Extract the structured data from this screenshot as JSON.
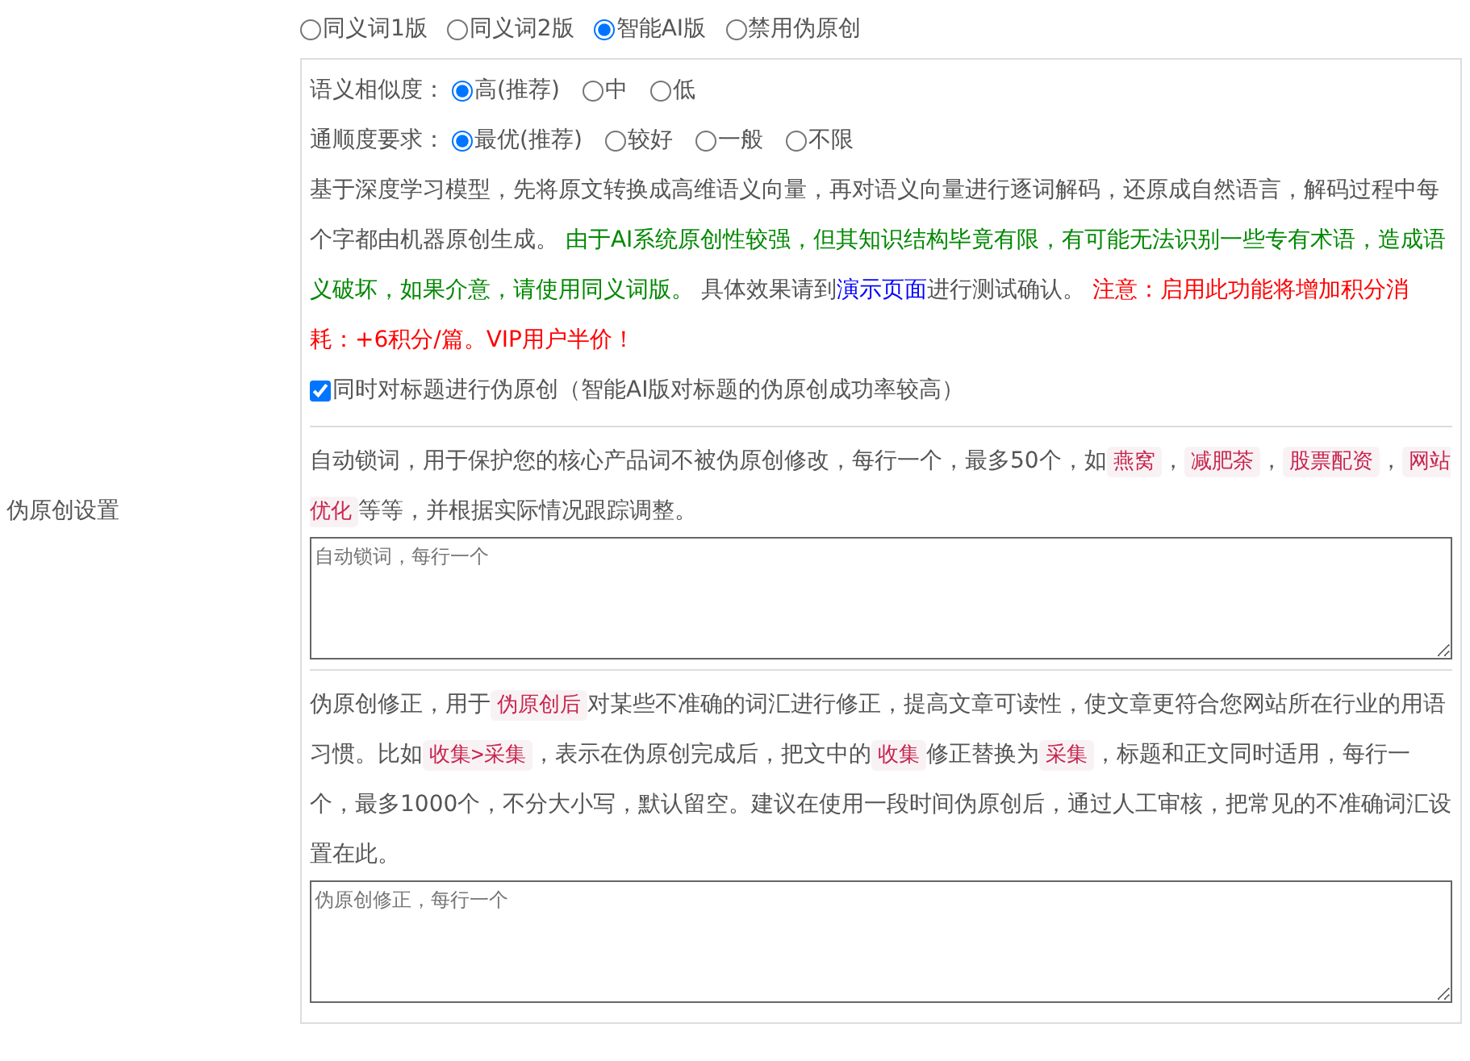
{
  "section_label": "伪原创设置",
  "modes": [
    {
      "label": "同义词1版",
      "selected": false
    },
    {
      "label": "同义词2版",
      "selected": false
    },
    {
      "label": "智能AI版",
      "selected": true
    },
    {
      "label": "禁用伪原创",
      "selected": false
    }
  ],
  "options": [
    {
      "label": "语义相似度：",
      "choices": [
        {
          "label": "高(推荐)",
          "selected": true
        },
        {
          "label": "中",
          "selected": false
        },
        {
          "label": "低",
          "selected": false
        }
      ]
    },
    {
      "label": "通顺度要求：",
      "choices": [
        {
          "label": "最优(推荐)",
          "selected": true
        },
        {
          "label": "较好",
          "selected": false
        },
        {
          "label": "一般",
          "selected": false
        },
        {
          "label": "不限",
          "selected": false
        }
      ]
    }
  ],
  "ai_description": [
    {
      "kind": "text",
      "text": "基于深度学习模型，先将原文转换成高维语义向量，再对语义向量进行逐词解码，还原成自然语言，解码过程中每个字都由机器原创生成。 "
    },
    {
      "kind": "notice",
      "text": "由于AI系统原创性较强，但其知识结构毕竟有限，有可能无法识别一些专有术语，造成语义破坏，如果介意，请使用同义词版。"
    },
    {
      "kind": "text",
      "text": " 具体效果请到"
    },
    {
      "kind": "link",
      "text": "演示页面"
    },
    {
      "kind": "text",
      "text": "进行测试确认。 "
    },
    {
      "kind": "warning",
      "text": "注意：启用此功能将增加积分消耗：+6积分/篇。VIP用户半价！"
    }
  ],
  "title_option": {
    "label": "同时对标题进行伪原创（智能AI版对标题的伪原创成功率较高）",
    "checked": true
  },
  "lock_words": {
    "description": [
      {
        "kind": "text",
        "text": "自动锁词，用于保护您的核心产品词不被伪原创修改，每行一个，最多50个，如"
      },
      {
        "kind": "code",
        "text": "燕窝"
      },
      {
        "kind": "text",
        "text": "，"
      },
      {
        "kind": "code",
        "text": "减肥茶"
      },
      {
        "kind": "text",
        "text": "，"
      },
      {
        "kind": "code",
        "text": "股票配资"
      },
      {
        "kind": "text",
        "text": "，"
      },
      {
        "kind": "code",
        "text": "网站优化"
      },
      {
        "kind": "text",
        "text": "等等，并根据实际情况跟踪调整。"
      }
    ],
    "placeholder": "自动锁词，每行一个"
  },
  "corrections": {
    "description": [
      {
        "kind": "text",
        "text": "伪原创修正，用于"
      },
      {
        "kind": "code",
        "text": "伪原创后"
      },
      {
        "kind": "text",
        "text": "对某些不准确的词汇进行修正，提高文章可读性，使文章更符合您网站所在行业的用语习惯。比如"
      },
      {
        "kind": "code",
        "text": "收集>采集"
      },
      {
        "kind": "text",
        "text": "，表示在伪原创完成后，把文中的"
      },
      {
        "kind": "code",
        "text": "收集"
      },
      {
        "kind": "text",
        "text": "修正替换为"
      },
      {
        "kind": "code",
        "text": "采集"
      },
      {
        "kind": "text",
        "text": "，标题和正文同时适用，每行一个，最多1000个，不分大小写，默认留空。建议在使用一段时间伪原创后，通过人工审核，把常见的不准确词汇设置在此。"
      }
    ],
    "placeholder": "伪原创修正，每行一个"
  }
}
